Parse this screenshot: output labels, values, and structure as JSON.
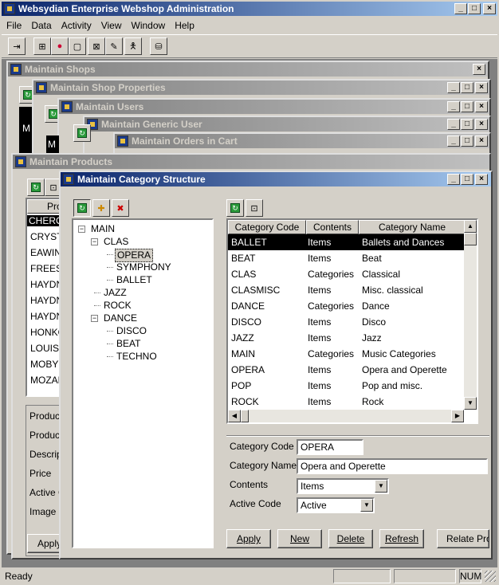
{
  "app": {
    "title": "Websydian Enterprise Webshop Administration"
  },
  "menu": [
    "File",
    "Data",
    "Activity",
    "View",
    "Window",
    "Help"
  ],
  "windows": {
    "shops": "Maintain Shops",
    "shop_props": "Maintain Shop Properties",
    "users": "Maintain Users",
    "generic_user": "Maintain Generic User",
    "orders": "Maintain Orders in Cart",
    "products": "Maintain Products",
    "category": "Maintain Category Structure"
  },
  "products_bg": {
    "header": "Pro",
    "list": [
      "CHERO",
      "CRYST",
      "EAWIN",
      "FREES",
      "HAYDN",
      "HAYDN",
      "HAYDN",
      "HONKO",
      "LOUIS",
      "MOBY",
      "MOZAR"
    ],
    "fields": [
      "Product",
      "Product",
      "Descrip",
      "Price",
      "Active C",
      "Image"
    ],
    "apply": "Apply"
  },
  "bg_cells": [
    "M",
    "M"
  ],
  "tree": [
    {
      "label": "MAIN",
      "level": 0,
      "expander": "−"
    },
    {
      "label": "CLAS",
      "level": 1,
      "expander": "−"
    },
    {
      "label": "OPERA",
      "level": 2,
      "selected": true
    },
    {
      "label": "SYMPHONY",
      "level": 2
    },
    {
      "label": "BALLET",
      "level": 2
    },
    {
      "label": "JAZZ",
      "level": 1
    },
    {
      "label": "ROCK",
      "level": 1
    },
    {
      "label": "DANCE",
      "level": 1,
      "expander": "−"
    },
    {
      "label": "DISCO",
      "level": 2
    },
    {
      "label": "BEAT",
      "level": 2
    },
    {
      "label": "TECHNO",
      "level": 2
    }
  ],
  "grid": {
    "columns": [
      "Category Code",
      "Contents",
      "Category Name"
    ],
    "rows": [
      [
        "BALLET",
        "Items",
        "Ballets and Dances"
      ],
      [
        "BEAT",
        "Items",
        "Beat"
      ],
      [
        "CLAS",
        "Categories",
        "Classical"
      ],
      [
        "CLASMISC",
        "Items",
        "Misc. classical"
      ],
      [
        "DANCE",
        "Categories",
        "Dance"
      ],
      [
        "DISCO",
        "Items",
        "Disco"
      ],
      [
        "JAZZ",
        "Items",
        "Jazz"
      ],
      [
        "MAIN",
        "Categories",
        "Music Categories"
      ],
      [
        "OPERA",
        "Items",
        "Opera and Operette"
      ],
      [
        "POP",
        "Items",
        "Pop and misc."
      ],
      [
        "ROCK",
        "Items",
        "Rock"
      ]
    ],
    "selected_row": 0
  },
  "form": {
    "code_label": "Category Code",
    "code_value": "OPERA",
    "name_label": "Category Name",
    "name_value": "Opera and Operette",
    "contents_label": "Contents",
    "contents_value": "Items",
    "active_label": "Active Code",
    "active_value": "Active"
  },
  "buttons": {
    "apply": "Apply",
    "new": "New",
    "delete": "Delete",
    "refresh": "Refresh",
    "relate": "Relate Pro"
  },
  "status": {
    "text": "Ready",
    "num": "NUM"
  },
  "colors": {
    "title_active": "#0a246a",
    "selection": "#000000",
    "face": "#d4d0c8"
  }
}
